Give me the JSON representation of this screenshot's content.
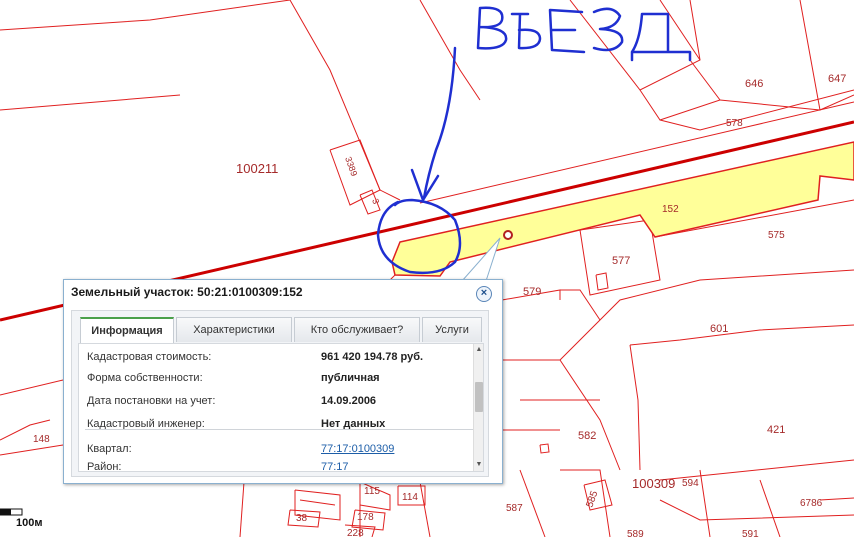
{
  "map": {
    "parcel_labels": {
      "p646": "646",
      "p647": "647",
      "p578": "578",
      "p152": "152",
      "p575": "575",
      "p577": "577",
      "p579": "579",
      "p601": "601",
      "p582": "582",
      "p421": "421",
      "p100309": "100309",
      "p594": "594",
      "p6786": "6786",
      "p585": "585",
      "p587": "587",
      "p589": "589",
      "p591": "591",
      "p148": "148",
      "p115": "115",
      "p114": "114",
      "p38": "38",
      "p178": "178",
      "p228": "228",
      "p3389": "3389",
      "p3": "3",
      "p100211": "100211"
    },
    "scale_label": "100м",
    "annotation_text": "ВЪЕЗД",
    "colors": {
      "parcel_line": "#e02020",
      "highlight_fill": "#ffff99",
      "road": "#cc0000",
      "annotation": "#1f2fd1"
    }
  },
  "popup": {
    "title": "Земельный участок: 50:21:0100309:152",
    "close_icon": "close-icon",
    "tabs": [
      {
        "label": "Информация",
        "active": true
      },
      {
        "label": "Характеристики",
        "active": false
      },
      {
        "label": "Кто обслуживает?",
        "active": false
      },
      {
        "label": "Услуги",
        "active": false
      }
    ],
    "rows": [
      {
        "label": "Кадастровая стоимость:",
        "value": "961 420 194.78 руб."
      },
      {
        "label": "Форма собственности:",
        "value": "публичная"
      },
      {
        "label": "Дата постановки на учет:",
        "value": "14.09.2006"
      },
      {
        "label": "Кадастровый инженер:",
        "value": "Нет данных"
      },
      {
        "label": "Квартал:",
        "value": "77:17:0100309"
      },
      {
        "label": "Район:",
        "value": "77:17"
      }
    ]
  }
}
